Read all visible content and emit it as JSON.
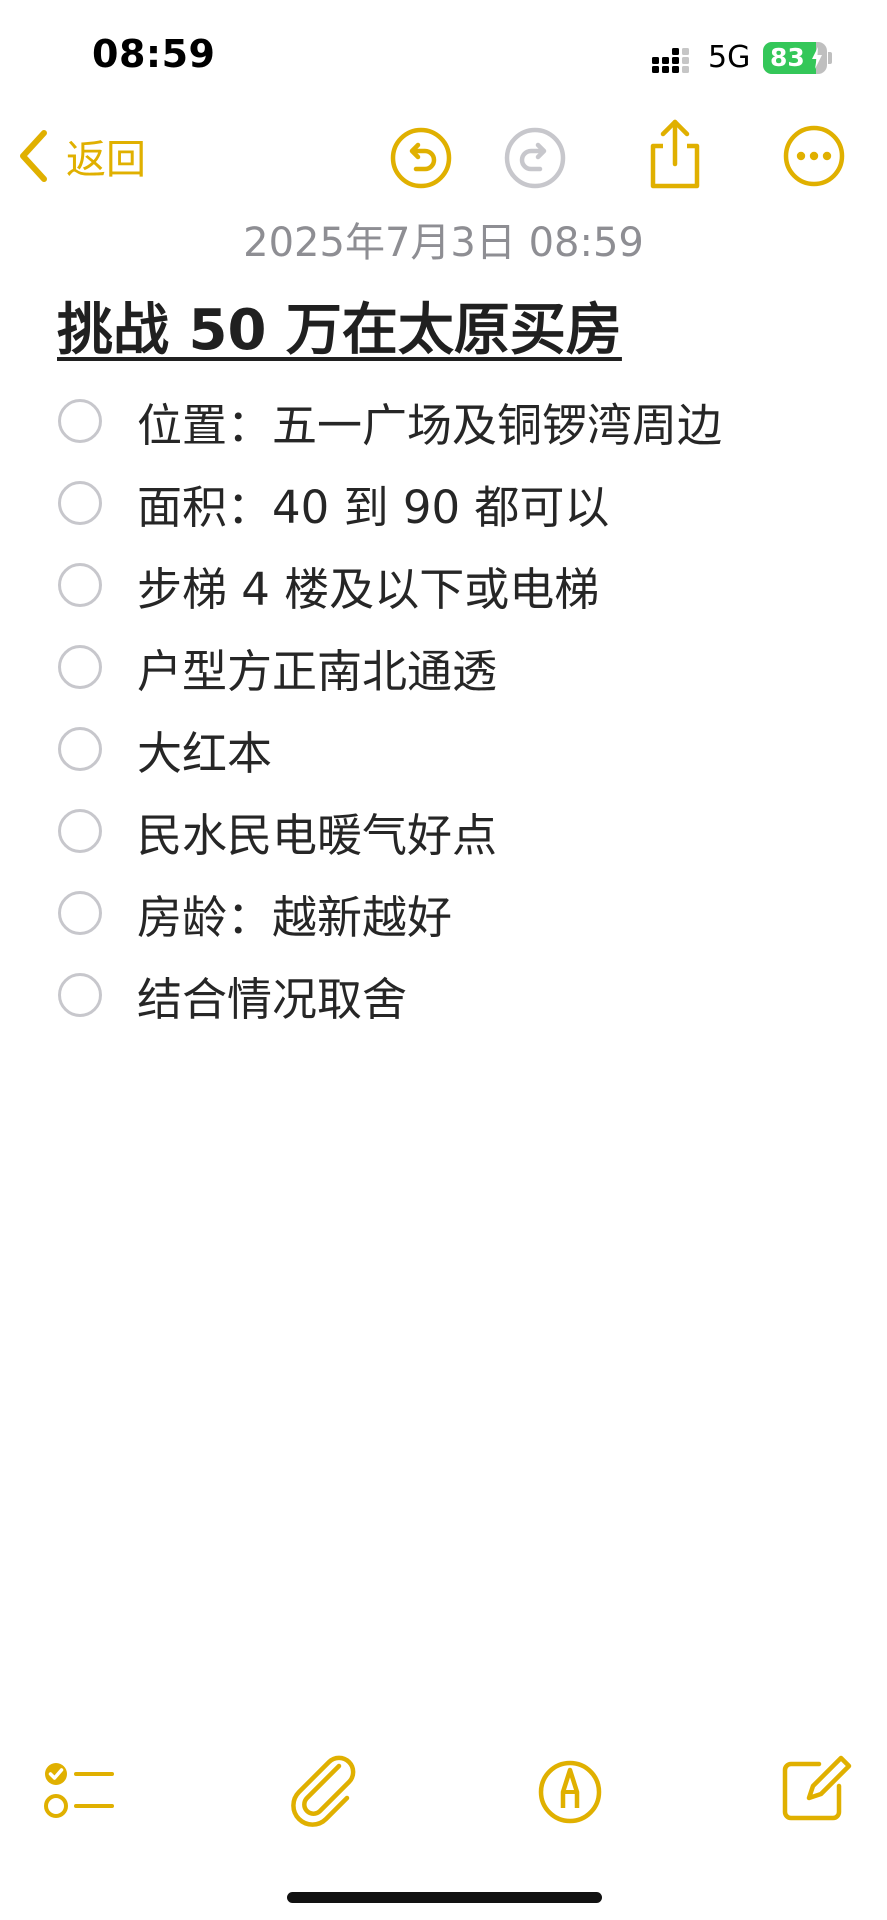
{
  "status_bar": {
    "time": "08:59",
    "network": "5G",
    "battery_percent": "83",
    "battery_level": 0.83,
    "battery_color": "#34c759",
    "signal_icon": "cellular-signal-icon",
    "battery_icon": "battery-charging-icon"
  },
  "nav": {
    "back_label": "返回",
    "back_icon": "chevron-left-icon",
    "undo_icon": "undo-icon",
    "redo_icon": "redo-icon",
    "share_icon": "share-icon",
    "more_icon": "more-ellipsis-icon",
    "accent_color": "#e0b000",
    "disabled_color": "#c7c7cc"
  },
  "note": {
    "date": "2025年7月3日 08:59",
    "title": "挑战 50 万在太原买房",
    "checklist": [
      {
        "text": "位置：五一广场及铜锣湾周边",
        "checked": false
      },
      {
        "text": "面积：40 到 90 都可以",
        "checked": false
      },
      {
        "text": "步梯 4 楼及以下或电梯",
        "checked": false
      },
      {
        "text": "户型方正南北通透",
        "checked": false
      },
      {
        "text": "大红本",
        "checked": false
      },
      {
        "text": "民水民电暖气好点",
        "checked": false
      },
      {
        "text": "房龄：越新越好",
        "checked": false
      },
      {
        "text": "结合情况取舍",
        "checked": false
      }
    ]
  },
  "toolbar": {
    "checklist_icon": "checklist-icon",
    "attach_icon": "paperclip-icon",
    "markup_icon": "markup-pen-icon",
    "compose_icon": "compose-icon"
  }
}
